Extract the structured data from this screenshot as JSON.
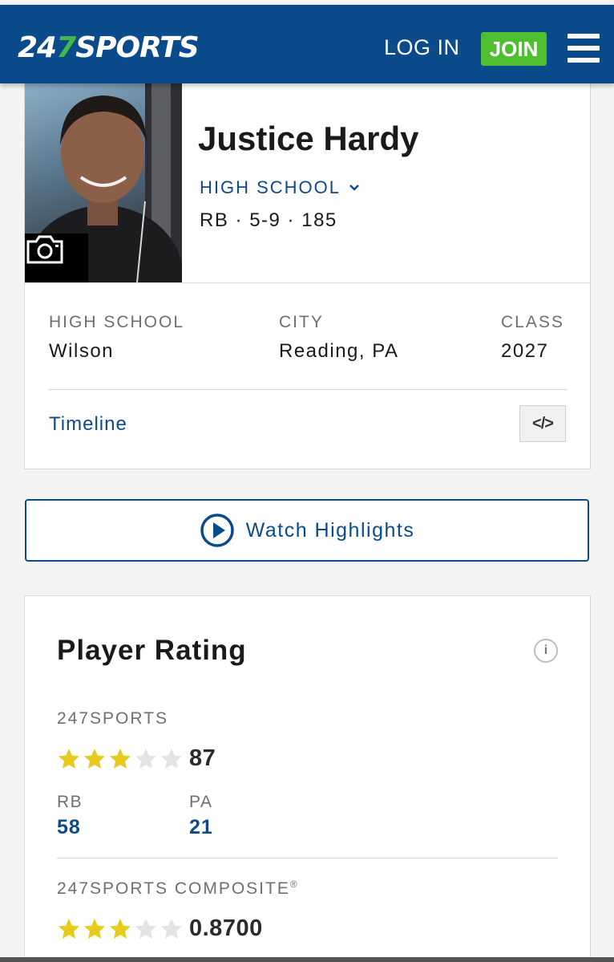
{
  "header": {
    "logo_prefix": "24",
    "logo_seven": "7",
    "logo_suffix": "SPORTS",
    "login_label": "LOG IN",
    "join_label": "JOIN",
    "colors": {
      "bar": "#0b4a8b",
      "join": "#4ec030",
      "logo_accent": "#47b848"
    }
  },
  "profile": {
    "name": "Justice Hardy",
    "level": "HIGH SCHOOL",
    "position": "RB",
    "height": "5-9",
    "weight": "185",
    "info": [
      {
        "label": "HIGH SCHOOL",
        "value": "Wilson"
      },
      {
        "label": "CITY",
        "value": "Reading, PA"
      },
      {
        "label": "CLASS",
        "value": "2027"
      }
    ],
    "timeline_label": "Timeline",
    "embed_label": "</>"
  },
  "highlights": {
    "label": "Watch Highlights"
  },
  "rating": {
    "title": "Player Rating",
    "info_label": "i",
    "sports247": {
      "label": "247SPORTS",
      "stars": 3,
      "stars_total": 5,
      "score": "87",
      "ranks": [
        {
          "label": "RB",
          "value": "58"
        },
        {
          "label": "PA",
          "value": "21"
        }
      ]
    },
    "composite": {
      "label": "247SPORTS COMPOSITE",
      "mark": "®",
      "stars": 3,
      "stars_total": 5,
      "score": "0.8700"
    },
    "colors": {
      "star_on": "#e5cc1c",
      "star_off": "#e3e3e3",
      "link": "#0b4a8b"
    }
  }
}
